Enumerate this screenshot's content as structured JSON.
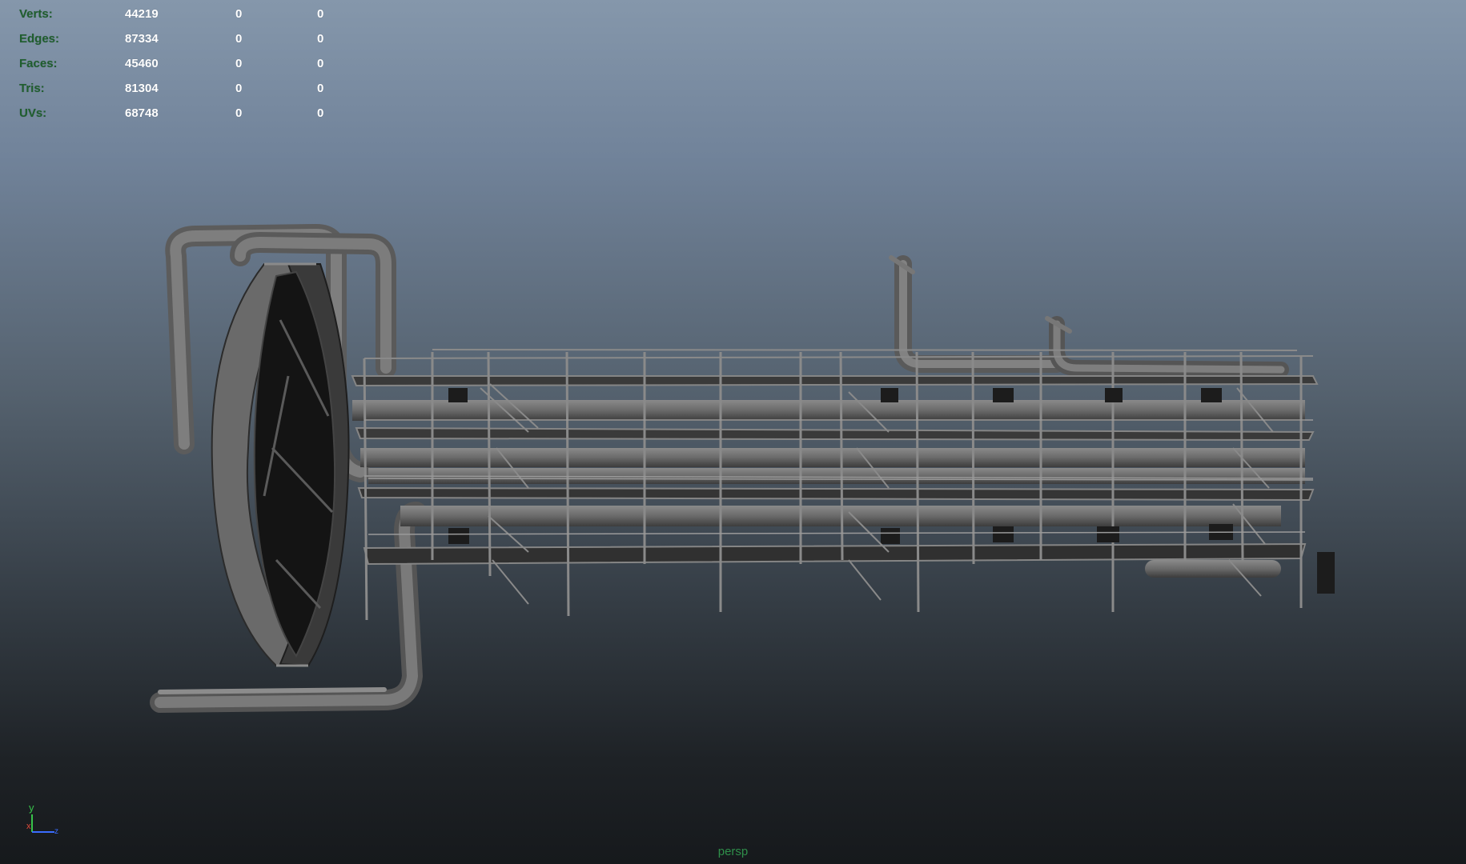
{
  "hud": {
    "rows": [
      {
        "label": "Verts:",
        "values": [
          "44219",
          "0",
          "0"
        ]
      },
      {
        "label": "Edges:",
        "values": [
          "87334",
          "0",
          "0"
        ]
      },
      {
        "label": "Faces:",
        "values": [
          "45460",
          "0",
          "0"
        ]
      },
      {
        "label": "Tris:",
        "values": [
          "81304",
          "0",
          "0"
        ]
      },
      {
        "label": "UVs:",
        "values": [
          "68748",
          "0",
          "0"
        ]
      }
    ]
  },
  "axis": {
    "y_label": "y",
    "x_label": "x",
    "z_label": "z"
  },
  "camera": {
    "name": "persp"
  },
  "colors": {
    "hud_label": "#1f5e2e",
    "hud_value": "#ffffff",
    "camera_label": "#2f8f4a",
    "model_gray": "#6e6e6e",
    "model_dark": "#2a2a2a"
  }
}
